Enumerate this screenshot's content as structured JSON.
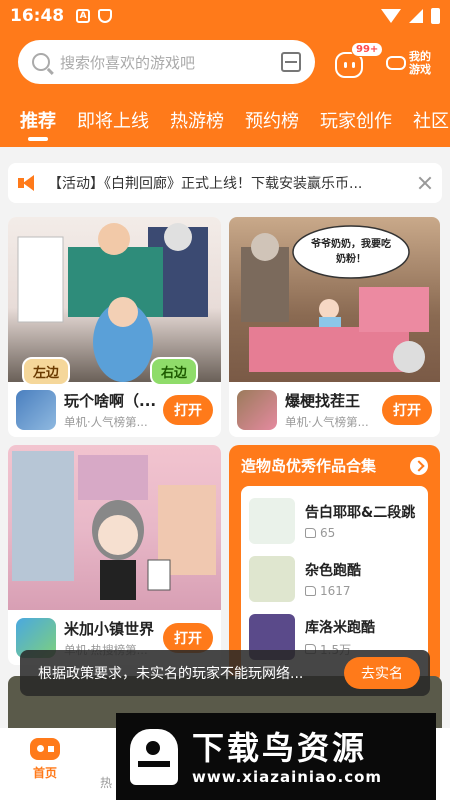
{
  "status": {
    "time": "16:48",
    "icons": [
      "a-icon",
      "shield-icon"
    ]
  },
  "header": {
    "search_placeholder": "搜索你喜欢的游戏吧",
    "message_badge": "99+",
    "my_games_label": "我的游戏",
    "tabs": [
      {
        "label": "推荐",
        "active": true
      },
      {
        "label": "即将上线"
      },
      {
        "label": "热游榜"
      },
      {
        "label": "预约榜"
      },
      {
        "label": "玩家创作"
      },
      {
        "label": "社区"
      }
    ]
  },
  "notice": {
    "text": "【活动】《白荆回廊》正式上线！下载安装赢乐币..."
  },
  "games": [
    {
      "name": "玩个啥啊（...",
      "sub": "单机·人气榜第...",
      "button": "打开",
      "tags": [
        "左边",
        "右边"
      ]
    },
    {
      "name": "爆梗找茬王",
      "sub": "单机·人气榜第...",
      "button": "打开",
      "bubble": "爷爷奶奶，我要吃奶粉！"
    },
    {
      "name": "米加小镇世界",
      "sub": "单机·热搜榜第...",
      "button": "打开"
    }
  ],
  "collection": {
    "title": "造物岛优秀作品合集",
    "items": [
      {
        "name": "告白耶耶&二段跳",
        "likes": "65"
      },
      {
        "name": "杂色跑酷",
        "likes": "1617"
      },
      {
        "name": "库洛米跑酷",
        "likes": "1.5万"
      }
    ]
  },
  "toast": {
    "text": "根据政策要求，未实名的玩家不能玩网络...",
    "button": "去实名"
  },
  "navbar": {
    "home_label": "首页",
    "partial_label": "热"
  },
  "watermark": {
    "title": "下载鸟资源",
    "url": "www.xiazainiao.com"
  },
  "colors": {
    "accent": "#ff7a1a"
  }
}
